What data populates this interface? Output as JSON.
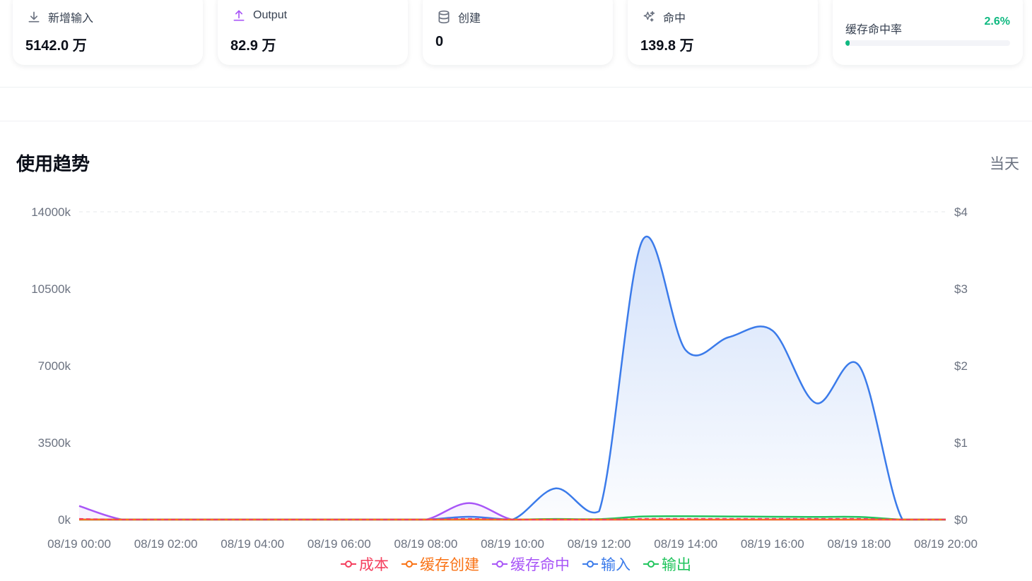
{
  "stats": {
    "new_input": {
      "label": "新增输入",
      "value": "5142.0 万",
      "icon": "download-icon"
    },
    "output": {
      "label": "Output",
      "value": "82.9 万",
      "icon": "upload-icon",
      "accent": "#a855f7"
    },
    "create": {
      "label": "创建",
      "value": "0",
      "icon": "database-icon"
    },
    "hit": {
      "label": "命中",
      "value": "139.8 万",
      "icon": "sparkles-icon"
    },
    "hit_rate": {
      "label": "缓存命中率",
      "value": "2.6%",
      "percent": 2.6,
      "color": "#10b981"
    }
  },
  "trend": {
    "title": "使用趋势",
    "range": "当天"
  },
  "chart_data": {
    "type": "line",
    "title": "使用趋势",
    "x": [
      "08/19 00:00",
      "08/19 01:00",
      "08/19 02:00",
      "08/19 03:00",
      "08/19 04:00",
      "08/19 05:00",
      "08/19 06:00",
      "08/19 07:00",
      "08/19 08:00",
      "08/19 09:00",
      "08/19 10:00",
      "08/19 11:00",
      "08/19 12:00",
      "08/19 13:00",
      "08/19 14:00",
      "08/19 15:00",
      "08/19 16:00",
      "08/19 17:00",
      "08/19 18:00",
      "08/19 19:00",
      "08/19 20:00"
    ],
    "x_tick_labels": [
      "08/19 00:00",
      "08/19 02:00",
      "08/19 04:00",
      "08/19 06:00",
      "08/19 08:00",
      "08/19 10:00",
      "08/19 12:00",
      "08/19 14:00",
      "08/19 16:00",
      "08/19 18:00",
      "08/19 20:00"
    ],
    "y_left": {
      "ticks": [
        "0k",
        "3500k",
        "7000k",
        "10500k",
        "14000k"
      ],
      "ylim": [
        0,
        14000000
      ]
    },
    "y_right": {
      "ticks": [
        "$0",
        "$1",
        "$2",
        "$3",
        "$4"
      ],
      "ylim": [
        0,
        4
      ]
    },
    "legend_position": "bottom",
    "grid": true,
    "series": [
      {
        "name": "成本",
        "color": "#f43f5e",
        "axis": "right",
        "dashed": true,
        "values": [
          0.01,
          0,
          0,
          0,
          0,
          0,
          0,
          0,
          0,
          0.01,
          0,
          0,
          0,
          0.01,
          0.01,
          0.01,
          0.01,
          0.01,
          0.01,
          0,
          0
        ]
      },
      {
        "name": "缓存创建",
        "color": "#f97316",
        "axis": "left",
        "values": [
          0,
          0,
          0,
          0,
          0,
          0,
          0,
          0,
          0,
          0,
          0,
          0,
          0,
          0,
          0,
          0,
          0,
          0,
          0,
          0,
          0
        ]
      },
      {
        "name": "缓存命中",
        "color": "#a855f7",
        "axis": "left",
        "values": [
          620000,
          0,
          0,
          0,
          0,
          0,
          0,
          0,
          0,
          750000,
          0,
          0,
          0,
          0,
          0,
          0,
          0,
          0,
          0,
          0,
          0
        ]
      },
      {
        "name": "输入",
        "color": "#3b7bea",
        "axis": "left",
        "fill": true,
        "values": [
          0,
          0,
          0,
          0,
          0,
          0,
          0,
          0,
          0,
          130000,
          0,
          1420000,
          380000,
          12700000,
          7700000,
          8300000,
          8600000,
          5300000,
          7000000,
          0,
          0
        ]
      },
      {
        "name": "输出",
        "color": "#22c55e",
        "axis": "left",
        "values": [
          0,
          0,
          0,
          0,
          0,
          0,
          0,
          0,
          0,
          0,
          0,
          30000,
          20000,
          140000,
          150000,
          140000,
          130000,
          120000,
          120000,
          0,
          0
        ]
      }
    ]
  }
}
